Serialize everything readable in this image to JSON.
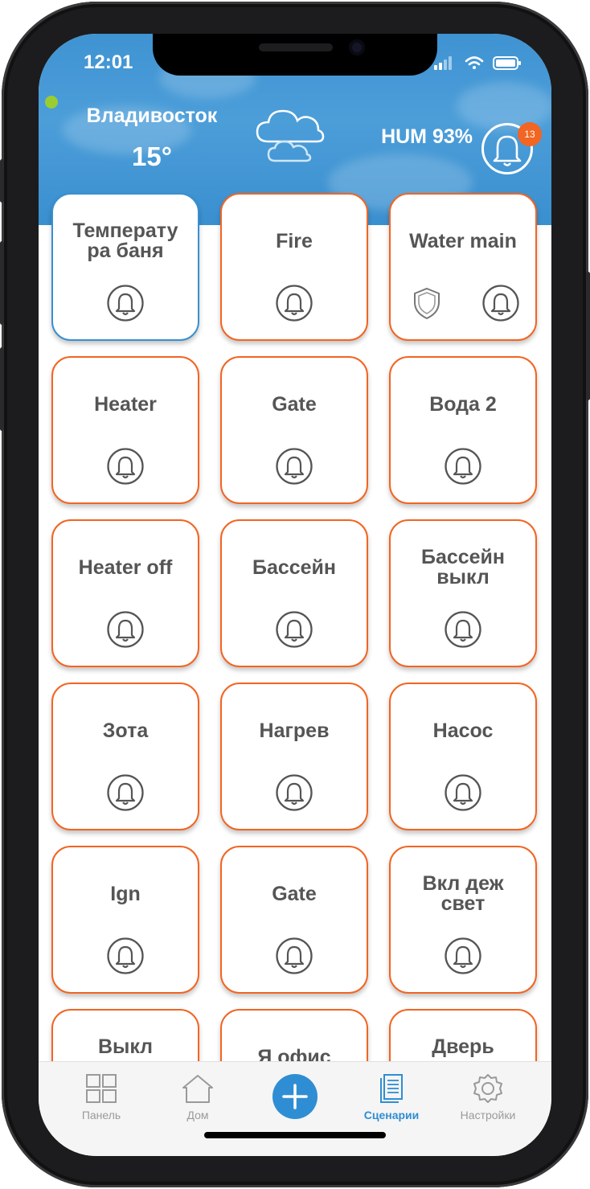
{
  "status_bar": {
    "time": "12:01"
  },
  "header": {
    "city": "Владивосток",
    "temperature": "15°",
    "humidity": "HUM 93%",
    "notification_count": "13",
    "weather_icon": "cloud-icon"
  },
  "tiles": [
    {
      "label": "Температу\nра баня",
      "border": "blue"
    },
    {
      "label": "Fire",
      "border": "orange"
    },
    {
      "label": "Water main",
      "border": "orange",
      "shield": true
    },
    {
      "label": "Heater",
      "border": "orange"
    },
    {
      "label": "Gate",
      "border": "orange"
    },
    {
      "label": "Вода 2",
      "border": "orange"
    },
    {
      "label": "Heater off",
      "border": "orange"
    },
    {
      "label": "Бассейн",
      "border": "orange"
    },
    {
      "label": "Бассейн\nвыкл",
      "border": "orange"
    },
    {
      "label": "Зота",
      "border": "orange"
    },
    {
      "label": "Нагрев",
      "border": "orange"
    },
    {
      "label": "Насос",
      "border": "orange"
    },
    {
      "label": "Ign",
      "border": "orange"
    },
    {
      "label": "Gate",
      "border": "orange"
    },
    {
      "label": "Вкл деж\nсвет",
      "border": "orange"
    },
    {
      "label": "Выкл\nдеж свет",
      "border": "orange"
    },
    {
      "label": "Я офис",
      "border": "orange"
    },
    {
      "label": "Дверь\nсауна",
      "border": "orange"
    }
  ],
  "tabbar": {
    "panel": "Панель",
    "home": "Дом",
    "scenarios": "Сценарии",
    "settings": "Настройки",
    "active": "scenarios"
  },
  "colors": {
    "accent": "#2f8ed3",
    "tile_border": "#f26522",
    "tile_border_alt": "#3a8fcf",
    "badge": "#f26522",
    "header": "#3f93d2"
  }
}
